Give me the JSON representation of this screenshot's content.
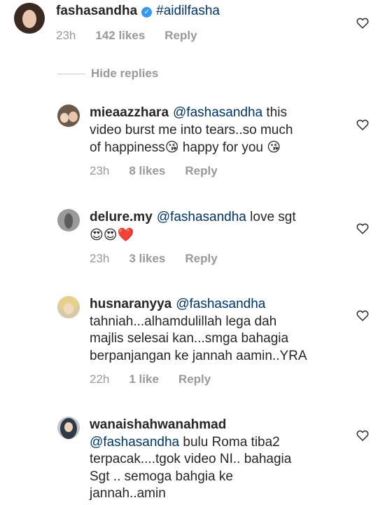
{
  "parent": {
    "username": "fashasandha",
    "hashtag": "#aidilfasha",
    "time": "23h",
    "likes": "142 likes",
    "reply": "Reply"
  },
  "hide_replies": "Hide replies",
  "replies": [
    {
      "username": "mieaazzhara",
      "mention": "@fashasandha",
      "line1_rest": " this",
      "line2": "video burst me into tears..so much",
      "line3_a": "of happiness",
      "emoji1": "😘",
      "line3_b": " happy for you ",
      "emoji2": "😘",
      "time": "23h",
      "likes": "8 likes",
      "reply": "Reply"
    },
    {
      "username": "delure.my",
      "mention": "@fashasandha",
      "rest": " love sgt",
      "emojis": "😍😍❤️",
      "time": "23h",
      "likes": "3 likes",
      "reply": "Reply"
    },
    {
      "username": "husnaranyya",
      "mention": "@fashasandha",
      "line2": "tahniah...alhamdulillah lega dah",
      "line3": "majlis selesai kan...smga bahagia",
      "line4": "berpanjangan ke jannah aamin..YRA",
      "time": "22h",
      "likes": "1 like",
      "reply": "Reply"
    },
    {
      "username": "wanaishahwanahmad",
      "mention": "@fashasandha",
      "line2_rest": " bulu Roma tiba2",
      "line3": "terpacak....tgok video NI.. bahagia",
      "line4": "Sgt .. semoga bahgia ke",
      "line5": "jannah..amin"
    }
  ],
  "colors": {
    "text": "#262626",
    "mention": "#003569",
    "meta": "#999999",
    "verified": "#3897f0"
  }
}
